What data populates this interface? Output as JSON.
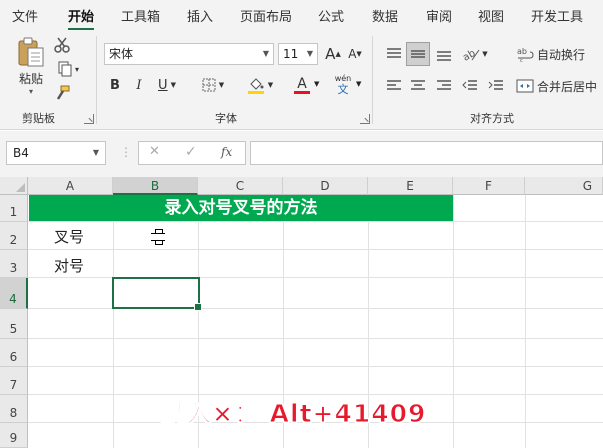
{
  "ribbon_tabs": [
    "文件",
    "开始",
    "工具箱",
    "插入",
    "页面布局",
    "公式",
    "数据",
    "审阅",
    "视图",
    "开发工具"
  ],
  "active_tab": "开始",
  "clipboard": {
    "paste_label": "粘贴",
    "group_label": "剪贴板"
  },
  "font": {
    "name": "宋体",
    "size": "11",
    "group_label": "字体",
    "bold": "B",
    "italic": "I",
    "underline": "U",
    "grow": "A",
    "shrink": "A",
    "phonetic_top": "wén",
    "phonetic_bottom": "文",
    "font_color_letter": "A"
  },
  "alignment": {
    "wrap_text": "自动换行",
    "merge_center": "合并后居中",
    "group_label": "对齐方式"
  },
  "formula_bar": {
    "name_box": "B4",
    "fx": "fx",
    "cancel": "✕",
    "confirm": "✓",
    "formula": ""
  },
  "columns": [
    "A",
    "B",
    "C",
    "D",
    "E",
    "F",
    "G"
  ],
  "rows": [
    "1",
    "2",
    "3",
    "4",
    "5",
    "6",
    "7",
    "8",
    "9"
  ],
  "selected_column": "B",
  "selected_row": "4",
  "cells": {
    "title": "录入对号叉号的方法",
    "a2": "叉号",
    "a3": "对号"
  },
  "overlay_text": "录入×： Alt+41409",
  "colors": {
    "accent": "#1e7145",
    "title_fill": "#00a94f",
    "overlay": "#e8192c",
    "font_color_bar": "#e81123",
    "fill_color_bar": "#ffd400"
  }
}
